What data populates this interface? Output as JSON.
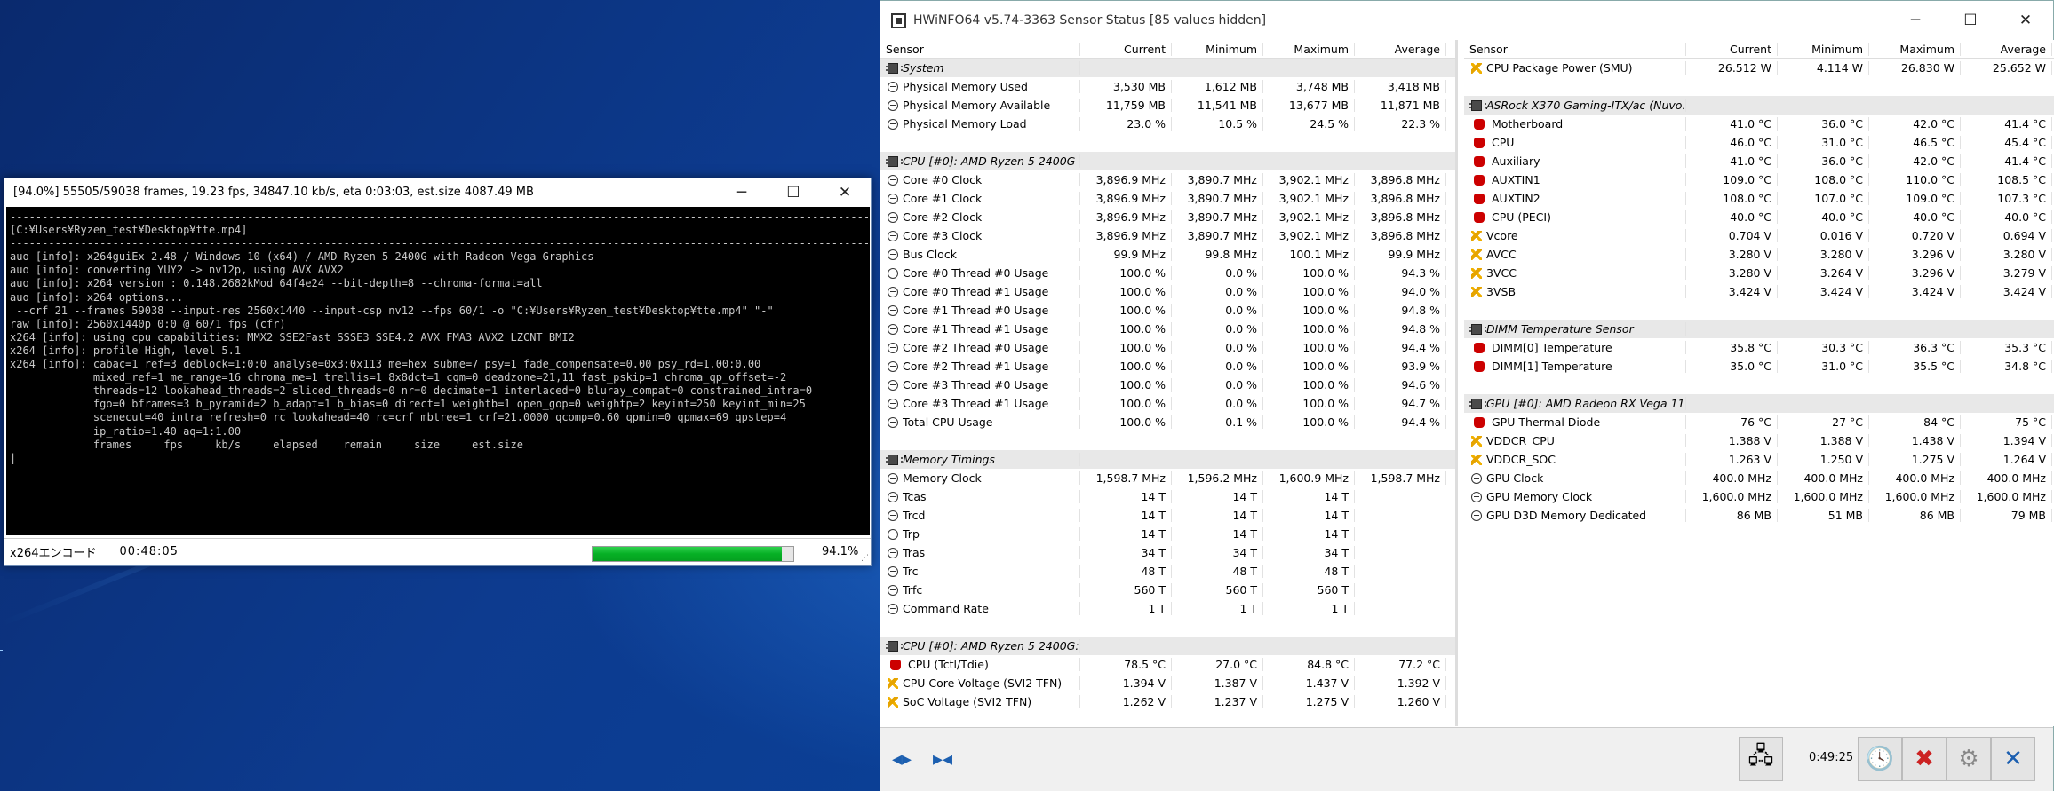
{
  "encoder": {
    "title": "[94.0%] 55505/59038 frames, 19.23 fps, 34847.10 kb/s, eta 0:03:03, est.size 4087.49 MB",
    "console": "--------------------------------------------------------------------------------------------------------------------------------------------------------------\n[C:¥Users¥Ryzen_test¥Desktop¥tte.mp4]\n--------------------------------------------------------------------------------------------------------------------------------------------------------------\nauo [info]: x264guiEx 2.48 / Windows 10 (x64) / AMD Ryzen 5 2400G with Radeon Vega Graphics\nauo [info]: converting YUY2 -> nv12p, using AVX AVX2\nauo [info]: x264 version : 0.148.2682kMod 64f4e24 --bit-depth=8 --chroma-format=all\nauo [info]: x264 options...\n --crf 21 --frames 59038 --input-res 2560x1440 --input-csp nv12 --fps 60/1 -o \"C:¥Users¥Ryzen_test¥Desktop¥tte.mp4\" \"-\"\nraw [info]: 2560x1440p 0:0 @ 60/1 fps (cfr)\nx264 [info]: using cpu capabilities: MMX2 SSE2Fast SSSE3 SSE4.2 AVX FMA3 AVX2 LZCNT BMI2\nx264 [info]: profile High, level 5.1\nx264 [info]: cabac=1 ref=3 deblock=1:0:0 analyse=0x3:0x113 me=hex subme=7 psy=1 fade_compensate=0.00 psy_rd=1.00:0.00\n             mixed_ref=1 me_range=16 chroma_me=1 trellis=1 8x8dct=1 cqm=0 deadzone=21,11 fast_pskip=1 chroma_qp_offset=-2\n             threads=12 lookahead_threads=2 sliced_threads=0 nr=0 decimate=1 interlaced=0 bluray_compat=0 constrained_intra=0\n             fgo=0 bframes=3 b_pyramid=2 b_adapt=1 b_bias=0 direct=1 weightb=1 open_gop=0 weightp=2 keyint=250 keyint_min=25\n             scenecut=40 intra_refresh=0 rc_lookahead=40 rc=crf mbtree=1 crf=21.0000 qcomp=0.60 qpmin=0 qpmax=69 qpstep=4\n             ip_ratio=1.40 aq=1:1.00\n             frames     fps     kb/s     elapsed    remain     size     est.size\n|",
    "status_label": "x264エンコード",
    "elapsed": "00:48:05",
    "progress_pct": 94.1,
    "progress_text": "94.1%"
  },
  "hwinfo": {
    "title": "HWiNFO64 v5.74-3363 Sensor Status [85 values hidden]",
    "columns": [
      "Sensor",
      "Current",
      "Minimum",
      "Maximum",
      "Average"
    ],
    "clock": "0:49:25",
    "left": [
      {
        "type": "group",
        "icon": "chip",
        "name": "System"
      },
      {
        "icon": "gauge",
        "name": "Physical Memory Used",
        "v": [
          "3,530 MB",
          "1,612 MB",
          "3,748 MB",
          "3,418 MB"
        ]
      },
      {
        "icon": "gauge",
        "name": "Physical Memory Available",
        "v": [
          "11,759 MB",
          "11,541 MB",
          "13,677 MB",
          "11,871 MB"
        ]
      },
      {
        "icon": "gauge",
        "name": "Physical Memory Load",
        "v": [
          "23.0 %",
          "10.5 %",
          "24.5 %",
          "22.3 %"
        ]
      },
      {
        "type": "blank"
      },
      {
        "type": "group",
        "icon": "chip",
        "name": "CPU [#0]: AMD Ryzen 5 2400G"
      },
      {
        "icon": "gauge",
        "name": "Core #0 Clock",
        "v": [
          "3,896.9 MHz",
          "3,890.7 MHz",
          "3,902.1 MHz",
          "3,896.8 MHz"
        ]
      },
      {
        "icon": "gauge",
        "name": "Core #1 Clock",
        "v": [
          "3,896.9 MHz",
          "3,890.7 MHz",
          "3,902.1 MHz",
          "3,896.8 MHz"
        ]
      },
      {
        "icon": "gauge",
        "name": "Core #2 Clock",
        "v": [
          "3,896.9 MHz",
          "3,890.7 MHz",
          "3,902.1 MHz",
          "3,896.8 MHz"
        ]
      },
      {
        "icon": "gauge",
        "name": "Core #3 Clock",
        "v": [
          "3,896.9 MHz",
          "3,890.7 MHz",
          "3,902.1 MHz",
          "3,896.8 MHz"
        ]
      },
      {
        "icon": "gauge",
        "name": "Bus Clock",
        "v": [
          "99.9 MHz",
          "99.8 MHz",
          "100.1 MHz",
          "99.9 MHz"
        ]
      },
      {
        "icon": "gauge",
        "name": "Core #0 Thread #0 Usage",
        "v": [
          "100.0 %",
          "0.0 %",
          "100.0 %",
          "94.3 %"
        ]
      },
      {
        "icon": "gauge",
        "name": "Core #0 Thread #1 Usage",
        "v": [
          "100.0 %",
          "0.0 %",
          "100.0 %",
          "94.0 %"
        ]
      },
      {
        "icon": "gauge",
        "name": "Core #1 Thread #0 Usage",
        "v": [
          "100.0 %",
          "0.0 %",
          "100.0 %",
          "94.8 %"
        ]
      },
      {
        "icon": "gauge",
        "name": "Core #1 Thread #1 Usage",
        "v": [
          "100.0 %",
          "0.0 %",
          "100.0 %",
          "94.8 %"
        ]
      },
      {
        "icon": "gauge",
        "name": "Core #2 Thread #0 Usage",
        "v": [
          "100.0 %",
          "0.0 %",
          "100.0 %",
          "94.4 %"
        ]
      },
      {
        "icon": "gauge",
        "name": "Core #2 Thread #1 Usage",
        "v": [
          "100.0 %",
          "0.0 %",
          "100.0 %",
          "93.9 %"
        ]
      },
      {
        "icon": "gauge",
        "name": "Core #3 Thread #0 Usage",
        "v": [
          "100.0 %",
          "0.0 %",
          "100.0 %",
          "94.6 %"
        ]
      },
      {
        "icon": "gauge",
        "name": "Core #3 Thread #1 Usage",
        "v": [
          "100.0 %",
          "0.0 %",
          "100.0 %",
          "94.7 %"
        ]
      },
      {
        "icon": "gauge",
        "name": "Total CPU Usage",
        "v": [
          "100.0 %",
          "0.1 %",
          "100.0 %",
          "94.4 %"
        ]
      },
      {
        "type": "blank"
      },
      {
        "type": "group",
        "icon": "chip",
        "name": "Memory Timings"
      },
      {
        "icon": "gauge",
        "name": "Memory Clock",
        "v": [
          "1,598.7 MHz",
          "1,596.2 MHz",
          "1,600.9 MHz",
          "1,598.7 MHz"
        ]
      },
      {
        "icon": "gauge",
        "name": "Tcas",
        "v": [
          "14 T",
          "14 T",
          "14 T",
          ""
        ]
      },
      {
        "icon": "gauge",
        "name": "Trcd",
        "v": [
          "14 T",
          "14 T",
          "14 T",
          ""
        ]
      },
      {
        "icon": "gauge",
        "name": "Trp",
        "v": [
          "14 T",
          "14 T",
          "14 T",
          ""
        ]
      },
      {
        "icon": "gauge",
        "name": "Tras",
        "v": [
          "34 T",
          "34 T",
          "34 T",
          ""
        ]
      },
      {
        "icon": "gauge",
        "name": "Trc",
        "v": [
          "48 T",
          "48 T",
          "48 T",
          ""
        ]
      },
      {
        "icon": "gauge",
        "name": "Trfc",
        "v": [
          "560 T",
          "560 T",
          "560 T",
          ""
        ]
      },
      {
        "icon": "gauge",
        "name": "Command Rate",
        "v": [
          "1 T",
          "1 T",
          "1 T",
          ""
        ]
      },
      {
        "type": "blank"
      },
      {
        "type": "group",
        "icon": "chip",
        "name": "CPU [#0]: AMD Ryzen 5 2400G: ..."
      },
      {
        "icon": "temp",
        "name": "CPU (Tctl/Tdie)",
        "v": [
          "78.5 °C",
          "27.0 °C",
          "84.8 °C",
          "77.2 °C"
        ]
      },
      {
        "icon": "volt",
        "name": "CPU Core Voltage (SVI2 TFN)",
        "v": [
          "1.394 V",
          "1.387 V",
          "1.437 V",
          "1.392 V"
        ]
      },
      {
        "icon": "volt",
        "name": "SoC Voltage (SVI2 TFN)",
        "v": [
          "1.262 V",
          "1.237 V",
          "1.275 V",
          "1.260 V"
        ]
      }
    ],
    "right": [
      {
        "icon": "volt",
        "name": "CPU Package Power (SMU)",
        "v": [
          "26.512 W",
          "4.114 W",
          "26.830 W",
          "25.652 W"
        ]
      },
      {
        "type": "blank"
      },
      {
        "type": "group",
        "icon": "chip",
        "name": "ASRock X370 Gaming-ITX/ac (Nuvo..."
      },
      {
        "icon": "temp",
        "name": "Motherboard",
        "v": [
          "41.0 °C",
          "36.0 °C",
          "42.0 °C",
          "41.4 °C"
        ]
      },
      {
        "icon": "temp",
        "name": "CPU",
        "v": [
          "46.0 °C",
          "31.0 °C",
          "46.5 °C",
          "45.4 °C"
        ]
      },
      {
        "icon": "temp",
        "name": "Auxiliary",
        "v": [
          "41.0 °C",
          "36.0 °C",
          "42.0 °C",
          "41.4 °C"
        ]
      },
      {
        "icon": "temp",
        "name": "AUXTIN1",
        "v": [
          "109.0 °C",
          "108.0 °C",
          "110.0 °C",
          "108.5 °C"
        ]
      },
      {
        "icon": "temp",
        "name": "AUXTIN2",
        "v": [
          "108.0 °C",
          "107.0 °C",
          "109.0 °C",
          "107.3 °C"
        ]
      },
      {
        "icon": "temp",
        "name": "CPU (PECI)",
        "v": [
          "40.0 °C",
          "40.0 °C",
          "40.0 °C",
          "40.0 °C"
        ]
      },
      {
        "icon": "volt",
        "name": "Vcore",
        "v": [
          "0.704 V",
          "0.016 V",
          "0.720 V",
          "0.694 V"
        ]
      },
      {
        "icon": "volt",
        "name": "AVCC",
        "v": [
          "3.280 V",
          "3.280 V",
          "3.296 V",
          "3.280 V"
        ]
      },
      {
        "icon": "volt",
        "name": "3VCC",
        "v": [
          "3.280 V",
          "3.264 V",
          "3.296 V",
          "3.279 V"
        ]
      },
      {
        "icon": "volt",
        "name": "3VSB",
        "v": [
          "3.424 V",
          "3.424 V",
          "3.424 V",
          "3.424 V"
        ]
      },
      {
        "type": "blank"
      },
      {
        "type": "group",
        "icon": "chip",
        "name": "DIMM Temperature Sensor"
      },
      {
        "icon": "temp",
        "name": "DIMM[0] Temperature",
        "v": [
          "35.8 °C",
          "30.3 °C",
          "36.3 °C",
          "35.3 °C"
        ]
      },
      {
        "icon": "temp",
        "name": "DIMM[1] Temperature",
        "v": [
          "35.0 °C",
          "31.0 °C",
          "35.5 °C",
          "34.8 °C"
        ]
      },
      {
        "type": "blank"
      },
      {
        "type": "group",
        "icon": "chip",
        "name": "GPU [#0]: AMD Radeon RX Vega 11:"
      },
      {
        "icon": "temp",
        "name": "GPU Thermal Diode",
        "v": [
          "76 °C",
          "27 °C",
          "84 °C",
          "75 °C"
        ]
      },
      {
        "icon": "volt",
        "name": "VDDCR_CPU",
        "v": [
          "1.388 V",
          "1.388 V",
          "1.438 V",
          "1.394 V"
        ]
      },
      {
        "icon": "volt",
        "name": "VDDCR_SOC",
        "v": [
          "1.263 V",
          "1.250 V",
          "1.275 V",
          "1.264 V"
        ]
      },
      {
        "icon": "gauge",
        "name": "GPU Clock",
        "v": [
          "400.0 MHz",
          "400.0 MHz",
          "400.0 MHz",
          "400.0 MHz"
        ]
      },
      {
        "icon": "gauge",
        "name": "GPU Memory Clock",
        "v": [
          "1,600.0 MHz",
          "1,600.0 MHz",
          "1,600.0 MHz",
          "1,600.0 MHz"
        ]
      },
      {
        "icon": "gauge",
        "name": "GPU D3D Memory Dedicated",
        "v": [
          "86 MB",
          "51 MB",
          "86 MB",
          "79 MB"
        ]
      }
    ]
  }
}
